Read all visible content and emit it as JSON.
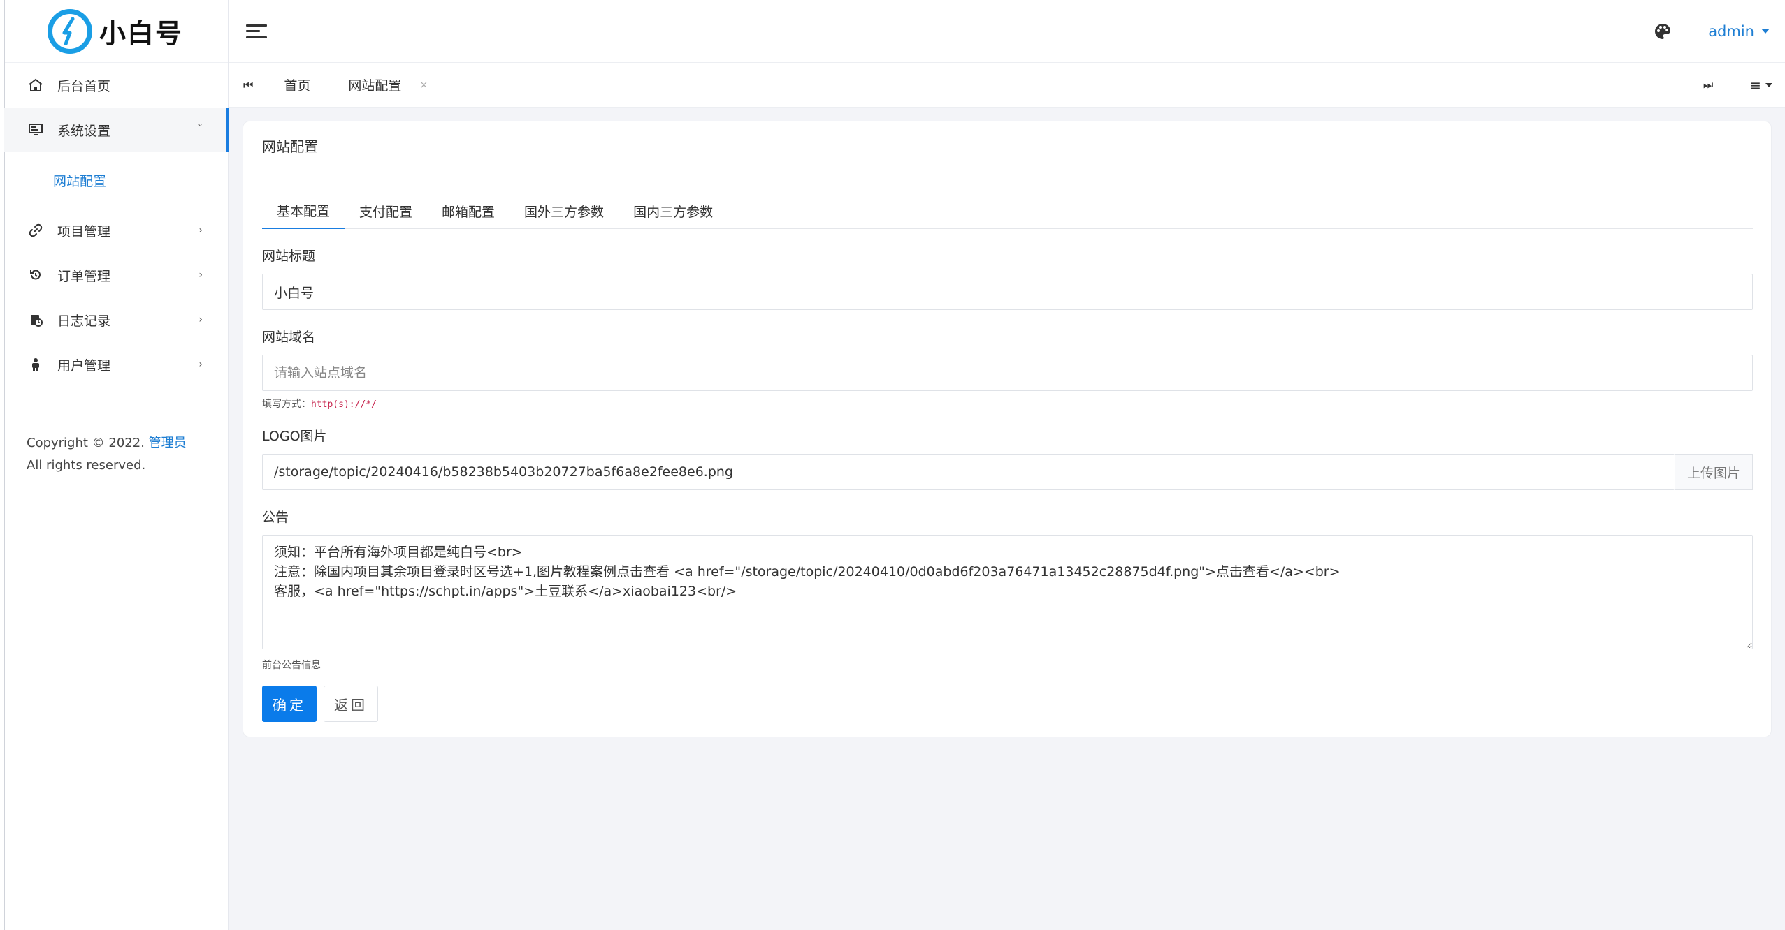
{
  "brand": {
    "name": "小白号",
    "accent": "#1a9ee5"
  },
  "sidebar": {
    "items": [
      {
        "label": "后台首页",
        "icon": "home-icon"
      },
      {
        "label": "系统设置",
        "icon": "monitor-icon"
      },
      {
        "label": "网站配置"
      },
      {
        "label": "项目管理",
        "icon": "link-icon"
      },
      {
        "label": "订单管理",
        "icon": "history-icon"
      },
      {
        "label": "日志记录",
        "icon": "log-icon"
      },
      {
        "label": "用户管理",
        "icon": "user-icon"
      }
    ],
    "copyright_pre": "Copyright © 2022. ",
    "copyright_link": "管理员",
    "copyright_post": " All rights reserved."
  },
  "header": {
    "user": "admin"
  },
  "tabs": {
    "items": [
      {
        "label": "首页"
      },
      {
        "label": "网站配置",
        "close": "×"
      }
    ]
  },
  "card": {
    "title": "网站配置",
    "form_tabs": [
      "基本配置",
      "支付配置",
      "邮箱配置",
      "国外三方参数",
      "国内三方参数"
    ],
    "fields": {
      "site_title": {
        "label": "网站标题",
        "value": "小白号"
      },
      "site_domain": {
        "label": "网站域名",
        "placeholder": "请输入站点域名",
        "hint_prefix": "填写方式：",
        "hint_code": "http(s)://*/"
      },
      "logo": {
        "label": "LOGO图片",
        "value": "/storage/topic/20240416/b58238b5403b20727ba5f6a8e2fee8e6.png",
        "upload_label": "上传图片"
      },
      "notice": {
        "label": "公告",
        "value": "须知：平台所有海外项目都是纯白号<br>\n注意：除国内项目其余项目登录时区号选+1,图片教程案例点击查看 <a href=\"/storage/topic/20240410/0d0abd6f203a76471a13452c28875d4f.png\">点击查看</a><br>\n客服，<a href=\"https://schpt.in/apps\">土豆联系</a>xiaobai123<br/>",
        "hint": "前台公告信息"
      }
    },
    "buttons": {
      "confirm": "确定",
      "back": "返回"
    }
  }
}
